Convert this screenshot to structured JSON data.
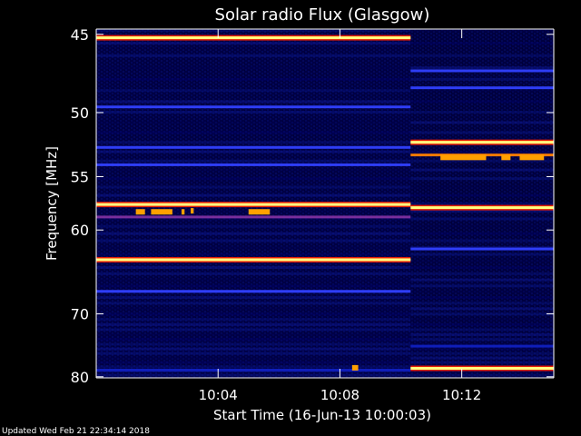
{
  "chart_data": {
    "type": "heatmap",
    "title": "Solar radio Flux (Glasgow)",
    "xlabel": "Start Time (16-Jun-13 10:00:03)",
    "ylabel": "Frequency [MHz]",
    "footer": "Updated Wed Feb 21 22:34:14 2018",
    "x_unit": "minutes after 10:00:03",
    "xlim": [
      0,
      15.02
    ],
    "ylim": [
      44.7,
      80.2
    ],
    "y_scale": "reciprocal",
    "x_ticks": [
      {
        "t": 4,
        "label": "10:04"
      },
      {
        "t": 8,
        "label": "10:08"
      },
      {
        "t": 12,
        "label": "10:12"
      }
    ],
    "y_ticks": [
      {
        "value": 45,
        "label": "45"
      },
      {
        "value": 50,
        "label": "50"
      },
      {
        "value": 55,
        "label": "55"
      },
      {
        "value": 60,
        "label": "60"
      },
      {
        "value": 70,
        "label": "70"
      },
      {
        "value": 80,
        "label": "80"
      }
    ],
    "segments": [
      {
        "t_start": 0,
        "t_end": 10.32,
        "lines": [
          {
            "freq": 45.2,
            "level": 1.0
          },
          {
            "freq": 49.6,
            "level": 0.4
          },
          {
            "freq": 52.6,
            "level": 0.35
          },
          {
            "freq": 54.0,
            "level": 0.4
          },
          {
            "freq": 57.5,
            "level": 0.9
          },
          {
            "freq": 58.7,
            "level": 0.55
          },
          {
            "freq": 63.2,
            "level": 1.0
          },
          {
            "freq": 67.0,
            "level": 0.4
          },
          {
            "freq": 78.8,
            "level": 0.25
          }
        ]
      },
      {
        "t_start": 10.32,
        "t_end": 15.02,
        "lines": [
          {
            "freq": 47.2,
            "level": 0.35
          },
          {
            "freq": 48.3,
            "level": 0.4
          },
          {
            "freq": 52.2,
            "level": 0.9
          },
          {
            "freq": 53.2,
            "level": 0.7
          },
          {
            "freq": 57.8,
            "level": 1.0
          },
          {
            "freq": 62.0,
            "level": 0.4
          },
          {
            "freq": 74.8,
            "level": 0.3
          },
          {
            "freq": 78.5,
            "level": 0.9
          }
        ]
      }
    ],
    "bursts": [
      {
        "t": 1.3,
        "freq": 58.2,
        "duration": 0.3
      },
      {
        "t": 1.8,
        "freq": 58.2,
        "duration": 0.7
      },
      {
        "t": 2.8,
        "freq": 58.2,
        "duration": 0.1
      },
      {
        "t": 3.1,
        "freq": 58.1,
        "duration": 0.1
      },
      {
        "t": 5.0,
        "freq": 58.2,
        "duration": 0.7
      },
      {
        "t": 8.4,
        "freq": 78.4,
        "duration": 0.2
      },
      {
        "t": 11.3,
        "freq": 53.4,
        "duration": 1.5
      },
      {
        "t": 13.3,
        "freq": 53.4,
        "duration": 0.3
      },
      {
        "t": 13.9,
        "freq": 53.4,
        "duration": 0.8
      }
    ],
    "colormap": [
      "#000010",
      "#000060",
      "#1020c0",
      "#3040ff",
      "#8030a0",
      "#ff2000",
      "#ff8000",
      "#ffff80",
      "#ffffff"
    ],
    "axis_color": "#ffffff",
    "background_color": "#000000"
  }
}
